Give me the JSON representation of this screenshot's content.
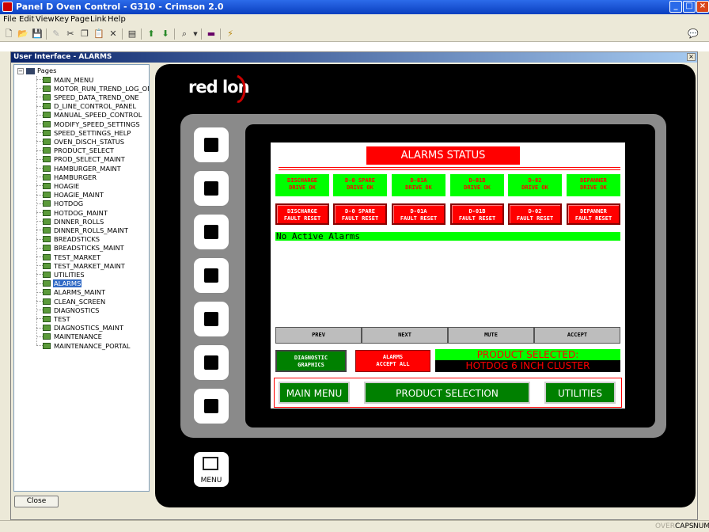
{
  "window": {
    "title": "Panel D Oven Control - G310 - Crimson 2.0"
  },
  "menu": [
    "File",
    "Edit",
    "View",
    "Key",
    "Page",
    "Link",
    "Help"
  ],
  "child": {
    "title": "User Interface - ALARMS"
  },
  "tree": {
    "root": "Pages",
    "items": [
      "MAIN_MENU",
      "MOTOR_RUN_TREND_LOG_ONE",
      "SPEED_DATA_TREND_ONE",
      "D_LINE_CONTROL_PANEL",
      "MANUAL_SPEED_CONTROL",
      "MODIFY_SPEED_SETTINGS",
      "SPEED_SETTINGS_HELP",
      "OVEN_DISCH_STATUS",
      "PRODUCT_SELECT",
      "PROD_SELECT_MAINT",
      "HAMBURGER_MAINT",
      "HAMBURGER",
      "HOAGIE",
      "HOAGIE_MAINT",
      "HOTDOG",
      "HOTDOG_MAINT",
      "DINNER_ROLLS",
      "DINNER_ROLLS_MAINT",
      "BREADSTICKS",
      "BREADSTICKS_MAINT",
      "TEST_MARKET",
      "TEST_MARKET_MAINT",
      "UTILITIES",
      "ALARMS",
      "ALARMS_MAINT",
      "CLEAN_SCREEN",
      "DIAGNOSTICS",
      "TEST",
      "DIAGNOSTICS_MAINT",
      "MAINTENANCE",
      "MAINTENANCE_PORTAL"
    ],
    "selected": "ALARMS"
  },
  "close_label": "Close",
  "logo": {
    "text_a": "red l",
    "text_b": "n"
  },
  "menu_key_label": "MENU",
  "hmi": {
    "title": "ALARMS STATUS",
    "drives": [
      {
        "l1": "DISCHARGE",
        "l2": "DRIVE OK"
      },
      {
        "l1": "D-0 SPARE",
        "l2": "DRIVE OK"
      },
      {
        "l1": "D-01A",
        "l2": "DRIVE OK"
      },
      {
        "l1": "D-01B",
        "l2": "DRIVE OK"
      },
      {
        "l1": "D-02",
        "l2": "DRIVE OK"
      },
      {
        "l1": "DEPANNER",
        "l2": "DRIVE OK"
      }
    ],
    "faults": [
      {
        "l1": "DISCHARGE",
        "l2": "FAULT RESET"
      },
      {
        "l1": "D-0 SPARE",
        "l2": "FAULT RESET"
      },
      {
        "l1": "D-01A",
        "l2": "FAULT RESET"
      },
      {
        "l1": "D-01B",
        "l2": "FAULT RESET"
      },
      {
        "l1": "D-02",
        "l2": "FAULT RESET"
      },
      {
        "l1": "DEPANNER",
        "l2": "FAULT RESET"
      }
    ],
    "no_alarms": "No Active Alarms",
    "nav": [
      "PREV",
      "NEXT",
      "MUTE",
      "ACCEPT"
    ],
    "diag": {
      "l1": "DIAGNOSTIC",
      "l2": "GRAPHICS"
    },
    "accept_all": {
      "l1": "ALARMS",
      "l2": "ACCEPT ALL"
    },
    "product_label": "PRODUCT SELECTED:",
    "product_value": "HOTDOG 6 INCH CLUSTER",
    "main_menu": "MAIN MENU",
    "product_selection": "PRODUCT SELECTION",
    "utilities": "UTILITIES"
  },
  "status": {
    "over": "OVER",
    "caps": "CAPS",
    "num": "NUM"
  },
  "colors": {
    "hmi_green": "#00ff00",
    "hmi_red": "#ff0000",
    "hmi_dark_green": "#008000"
  }
}
